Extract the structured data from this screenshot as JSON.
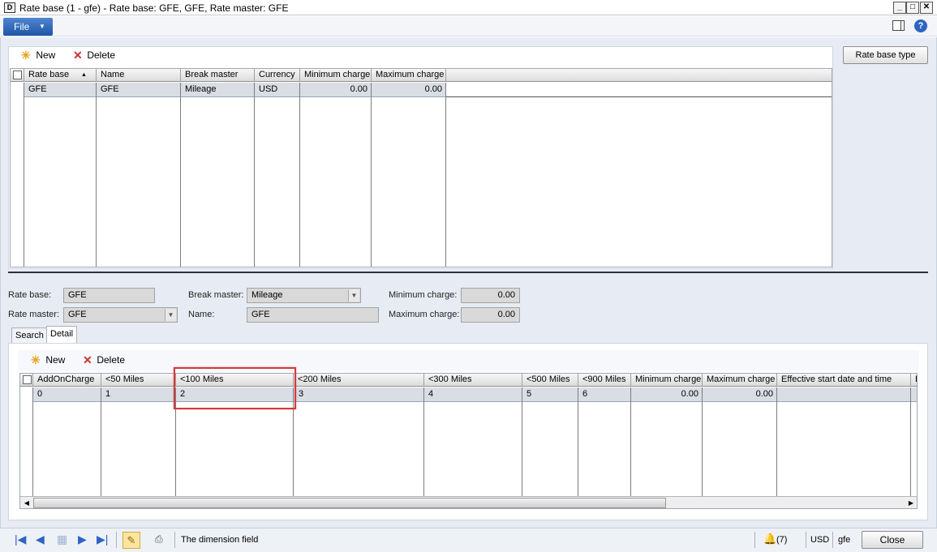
{
  "window": {
    "title": "Rate base (1 - gfe) - Rate base: GFE, GFE, Rate master: GFE",
    "app_icon": "app-icon"
  },
  "menu": {
    "file_label": "File"
  },
  "top_toolbar": {
    "new_label": "New",
    "delete_label": "Delete",
    "rate_base_type_label": "Rate base type"
  },
  "top_grid": {
    "columns": [
      "Rate base",
      "Name",
      "Break master",
      "Currency",
      "Minimum charge",
      "Maximum charge"
    ],
    "sort_indicator": "▲",
    "rows": [
      [
        "GFE",
        "GFE",
        "Mileage",
        "USD",
        "0.00",
        "0.00"
      ]
    ]
  },
  "form": {
    "rate_base_label": "Rate base:",
    "rate_base_value": "GFE",
    "rate_master_label": "Rate master:",
    "rate_master_value": "GFE",
    "break_master_label": "Break master:",
    "break_master_value": "Mileage",
    "name_label": "Name:",
    "name_value": "GFE",
    "min_charge_label": "Minimum charge:",
    "min_charge_value": "0.00",
    "max_charge_label": "Maximum charge:",
    "max_charge_value": "0.00"
  },
  "tabs": [
    "Search",
    "Detail"
  ],
  "detail_toolbar": {
    "new_label": "New",
    "delete_label": "Delete"
  },
  "detail_grid": {
    "columns": [
      "AddOnCharge",
      "<50 Miles",
      "<100 Miles",
      "<200 Miles",
      "<300 Miles",
      "<500 Miles",
      "<900 Miles",
      "Minimum charge",
      "Maximum charge",
      "Effective start date and time",
      "E"
    ],
    "rows": [
      [
        "0",
        "1",
        "2",
        "3",
        "4",
        "5",
        "6",
        "0.00",
        "0.00",
        "",
        ""
      ]
    ]
  },
  "status": {
    "message": "The dimension field",
    "alerts": "(7)",
    "currency": "USD",
    "company": "gfe",
    "close_label": "Close"
  },
  "colors": {
    "accent": "#1f55a6",
    "highlight_box": "#d23a3a",
    "row_selected": "#d9dde4"
  }
}
